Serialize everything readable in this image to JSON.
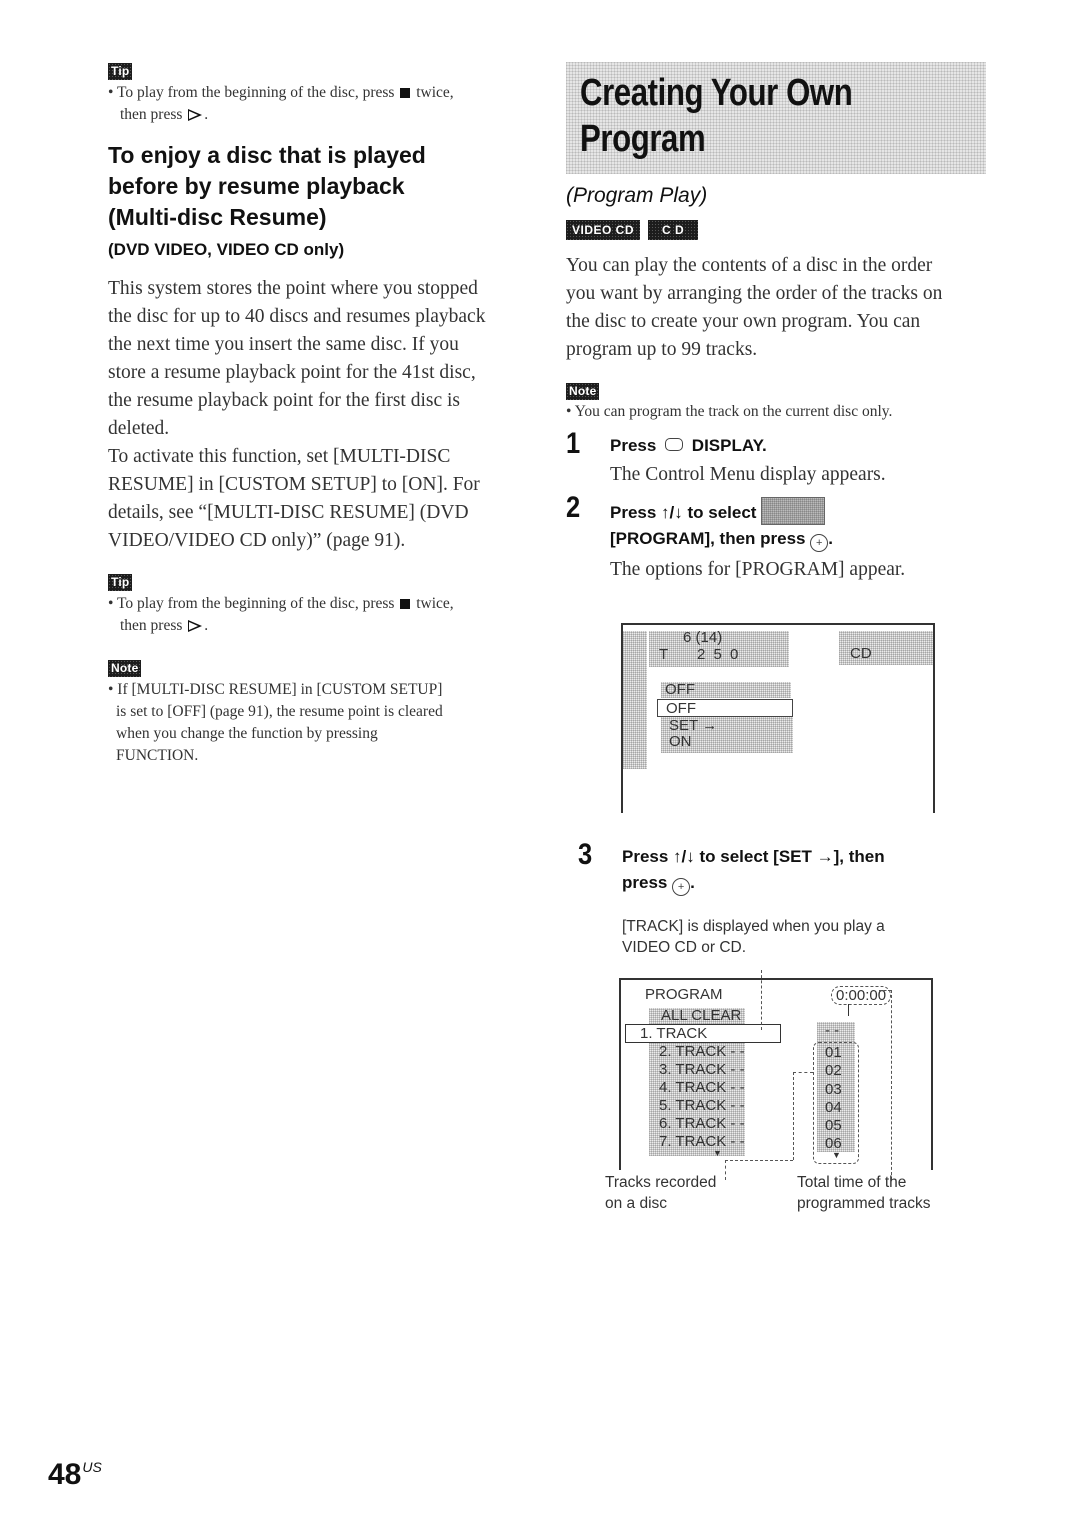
{
  "left": {
    "tip1": {
      "badge": "Tip",
      "text_a": "• To play from the beginning of the disc, press",
      "stop_icon": "stop-icon",
      "text_b": "twice,",
      "text_c": "then press",
      "play_icon": "play-icon",
      "text_d": "."
    },
    "section_title_lines": [
      "To enjoy a disc that is played",
      "before by resume playback",
      "(Multi-disc Resume)"
    ],
    "section_subtitle": "(DVD VIDEO, VIDEO CD only)",
    "para1_lines": [
      "This system stores the point where you stopped",
      "the disc for up to 40 discs and resumes playback",
      "the next time you insert the same disc. If you",
      "store a resume playback point for the 41st disc,",
      "the resume playback point for the first disc is",
      "deleted."
    ],
    "para2_lines": [
      "To activate this function, set [MULTI-DISC",
      "RESUME] in [CUSTOM SETUP] to [ON]. For",
      "details, see “[MULTI-DISC RESUME] (DVD",
      "VIDEO/VIDEO CD only)” (page 91)."
    ],
    "tip2": {
      "badge": "Tip",
      "text_a": "• To play from the beginning of the disc, press",
      "text_b": "twice,",
      "text_c": "then press",
      "text_d": "."
    },
    "note": {
      "badge": "Note",
      "lines": [
        "• If [MULTI-DISC RESUME] in [CUSTOM SETUP]",
        "is set to [OFF] (page 91), the resume point is cleared",
        "when you change the function by pressing",
        "FUNCTION."
      ]
    }
  },
  "right": {
    "title_lines": [
      "Creating Your Own",
      "Program"
    ],
    "subtitle": "(Program Play)",
    "disc_badges": [
      "VIDEO CD",
      "C D"
    ],
    "intro_lines": [
      "You can play the contents of a disc in the order",
      "you want by arranging the order of the tracks on",
      "the disc to create your own program. You can",
      "program up to 99 tracks."
    ],
    "note": {
      "badge": "Note",
      "text": "• You can program the track on the current disc only."
    },
    "steps": [
      {
        "num": "1",
        "head_a": "Press",
        "head_b": "DISPLAY.",
        "body": "The Control Menu display appears."
      },
      {
        "num": "2",
        "head_a": "Press ↑/↓ to select",
        "head_b": "[PROGRAM], then press",
        "enter_symbol": "+",
        "head_c": ".",
        "body": "The options for [PROGRAM] appear."
      },
      {
        "num": "3",
        "head_a": "Press ↑/↓ to select [SET →], then",
        "head_b": "press",
        "enter_symbol": "+",
        "head_c": ".",
        "body_lines": [
          "[TRACK] is displayed when you play a",
          "VIDEO CD or CD."
        ]
      }
    ],
    "screen1": {
      "chapter": "6 (14)",
      "time_label": "T",
      "time_value": "2 5 0",
      "disc_type": "CD",
      "current_value": "OFF",
      "options": [
        "OFF",
        "SET →",
        "ON"
      ],
      "selected_option": "OFF"
    },
    "screen2": {
      "header": "PROGRAM",
      "total_time": "0:00:00",
      "all_clear": "ALL CLEAR",
      "tracks": [
        "1. TRACK",
        "2. TRACK  - -",
        "3. TRACK  - -",
        "4. TRACK  - -",
        "5. TRACK  - -",
        "6. TRACK  - -",
        "7. TRACK  - -"
      ],
      "selected_track": "1. TRACK",
      "list_header": "- -",
      "track_numbers": [
        "01",
        "02",
        "03",
        "04",
        "05",
        "06"
      ],
      "scroll_down_symbol": "▼"
    },
    "captions": {
      "left_lines": [
        "Tracks recorded",
        "on a disc"
      ],
      "right_lines": [
        "Total time of the",
        "programmed tracks"
      ]
    }
  },
  "footer": {
    "page_number": "48",
    "region": "US"
  }
}
